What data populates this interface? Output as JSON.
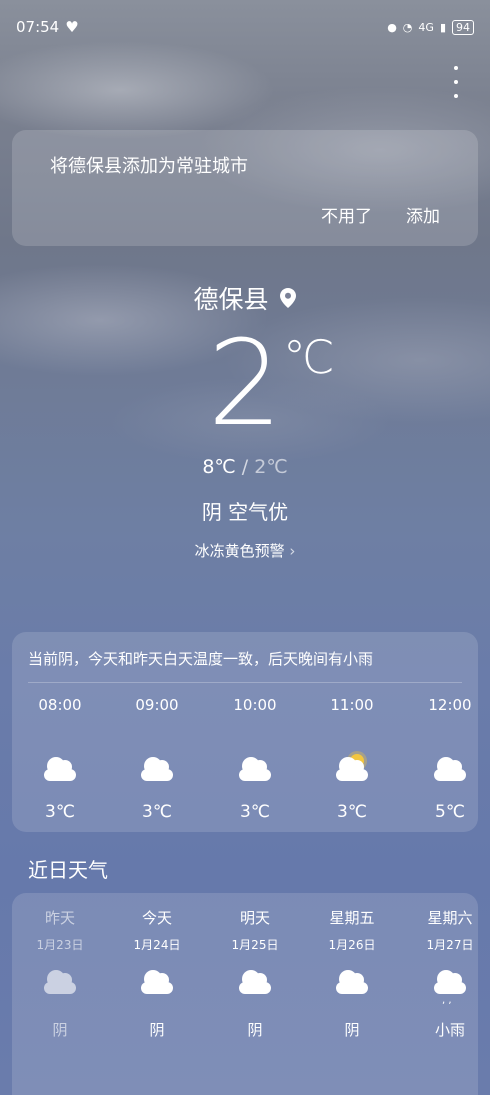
{
  "status": {
    "time": "07:54",
    "network": "4G",
    "battery": "94"
  },
  "banner": {
    "message": "将德保县添加为常驻城市",
    "dismiss_label": "不用了",
    "add_label": "添加"
  },
  "current": {
    "city": "德保县",
    "temperature": "2",
    "unit": "℃",
    "high": "8℃",
    "low": "2℃",
    "condition": "阴",
    "air_quality": "空气优",
    "warning": "冰冻黄色预警"
  },
  "hourly": {
    "summary": "当前阴，今天和昨天白天温度一致，后天晚间有小雨",
    "items": [
      {
        "time": "08:00",
        "icon": "cloud-icon",
        "temp": "3℃"
      },
      {
        "time": "09:00",
        "icon": "cloud-icon",
        "temp": "3℃"
      },
      {
        "time": "10:00",
        "icon": "cloud-icon",
        "temp": "3℃"
      },
      {
        "time": "11:00",
        "icon": "partly-sunny-icon",
        "temp": "3℃"
      },
      {
        "time": "12:00",
        "icon": "cloud-icon",
        "temp": "5℃"
      }
    ]
  },
  "daily": {
    "title": "近日天气",
    "items": [
      {
        "day": "昨天",
        "date": "1月23日",
        "icon": "cloud-icon",
        "condition": "阴"
      },
      {
        "day": "今天",
        "date": "1月24日",
        "icon": "cloud-icon",
        "condition": "阴"
      },
      {
        "day": "明天",
        "date": "1月25日",
        "icon": "cloud-icon",
        "condition": "阴"
      },
      {
        "day": "星期五",
        "date": "1月26日",
        "icon": "cloud-icon",
        "condition": "阴"
      },
      {
        "day": "星期六",
        "date": "1月27日",
        "icon": "rain-icon",
        "condition": "小雨"
      }
    ]
  }
}
